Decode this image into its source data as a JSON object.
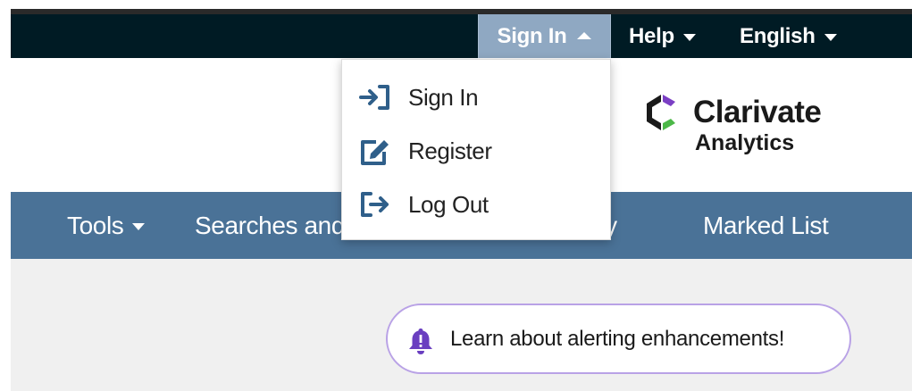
{
  "top_nav": {
    "sign_in": "Sign In",
    "help": "Help",
    "language": "English"
  },
  "logo": {
    "name": "Clarivate",
    "sub": "Analytics"
  },
  "main_nav": {
    "tools": "Tools",
    "searches_fragment": "Searches and",
    "history_fragment": "story",
    "marked_list": "Marked List"
  },
  "dropdown": {
    "items": [
      {
        "label": "Sign In",
        "icon": "sign-in-icon"
      },
      {
        "label": "Register",
        "icon": "edit-icon"
      },
      {
        "label": "Log Out",
        "icon": "sign-out-icon"
      }
    ]
  },
  "alert": {
    "text": "Learn about alerting enhancements!",
    "icon": "bell-icon"
  },
  "colors": {
    "top_bar": "#001b24",
    "main_nav": "#4a7297",
    "active_tab": "#8fa8c2",
    "icon_blue": "#2f5f8a",
    "alert_purple": "#6a3fc0",
    "alert_border": "#b9a2e6"
  }
}
